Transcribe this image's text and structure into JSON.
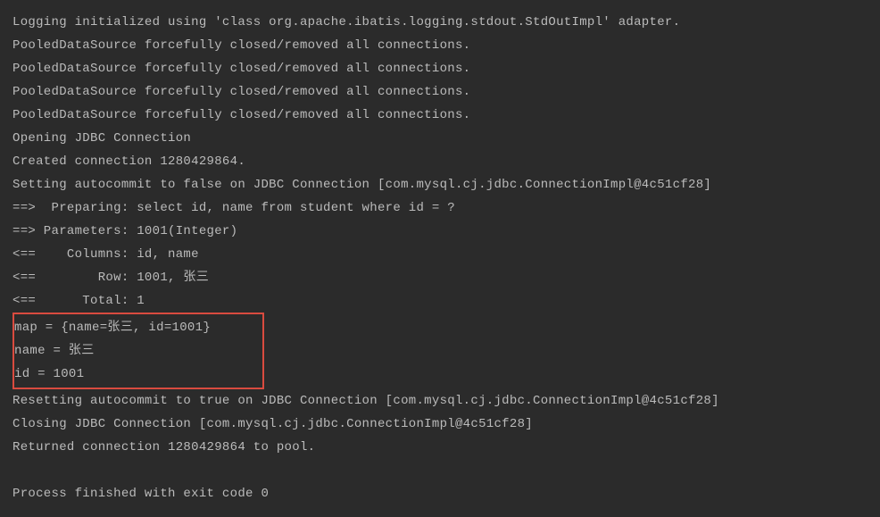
{
  "console": {
    "lines": [
      "Logging initialized using 'class org.apache.ibatis.logging.stdout.StdOutImpl' adapter.",
      "PooledDataSource forcefully closed/removed all connections.",
      "PooledDataSource forcefully closed/removed all connections.",
      "PooledDataSource forcefully closed/removed all connections.",
      "PooledDataSource forcefully closed/removed all connections.",
      "Opening JDBC Connection",
      "Created connection 1280429864.",
      "Setting autocommit to false on JDBC Connection [com.mysql.cj.jdbc.ConnectionImpl@4c51cf28]",
      "==>  Preparing: select id, name from student where id = ?",
      "==> Parameters: 1001(Integer)",
      "<==    Columns: id, name",
      "<==        Row: 1001, 张三",
      "<==      Total: 1"
    ],
    "highlighted": [
      "map = {name=张三, id=1001}",
      "name = 张三",
      "id = 1001"
    ],
    "after": [
      "Resetting autocommit to true on JDBC Connection [com.mysql.cj.jdbc.ConnectionImpl@4c51cf28]",
      "Closing JDBC Connection [com.mysql.cj.jdbc.ConnectionImpl@4c51cf28]",
      "Returned connection 1280429864 to pool.",
      "",
      "Process finished with exit code 0"
    ]
  }
}
